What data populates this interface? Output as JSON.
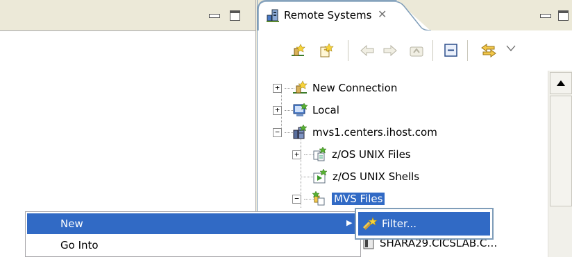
{
  "remote_systems": {
    "tab_title": "Remote Systems",
    "close_glyph": "✕",
    "tree": [
      {
        "label": "New Connection",
        "icon": "new-connection-icon",
        "expander": "+"
      },
      {
        "label": "Local",
        "icon": "local-computer-icon",
        "expander": "+"
      },
      {
        "label": "mvs1.centers.ihost.com",
        "icon": "host-server-icon",
        "expander": "−"
      },
      {
        "label": "z/OS UNIX Files",
        "icon": "unix-files-icon",
        "expander": "+"
      },
      {
        "label": "z/OS UNIX Shells",
        "icon": "unix-shells-icon",
        "expander": ""
      },
      {
        "label": "MVS Files",
        "icon": "mvs-files-icon",
        "expander": "−"
      },
      {
        "label": "SHARA29.CICSLAB.C…",
        "icon": "dataset-icon",
        "expander": ""
      }
    ]
  },
  "context_menu": {
    "items": [
      {
        "label": "New",
        "has_submenu": true
      },
      {
        "label": "Go Into",
        "has_submenu": false
      }
    ],
    "submenu_arrow": "▶"
  },
  "submenu": {
    "items": [
      {
        "label": "Filter..."
      }
    ]
  },
  "colors": {
    "selection": "#316ac5",
    "panel_bg": "#ece9d8",
    "border": "#7f9db9"
  }
}
